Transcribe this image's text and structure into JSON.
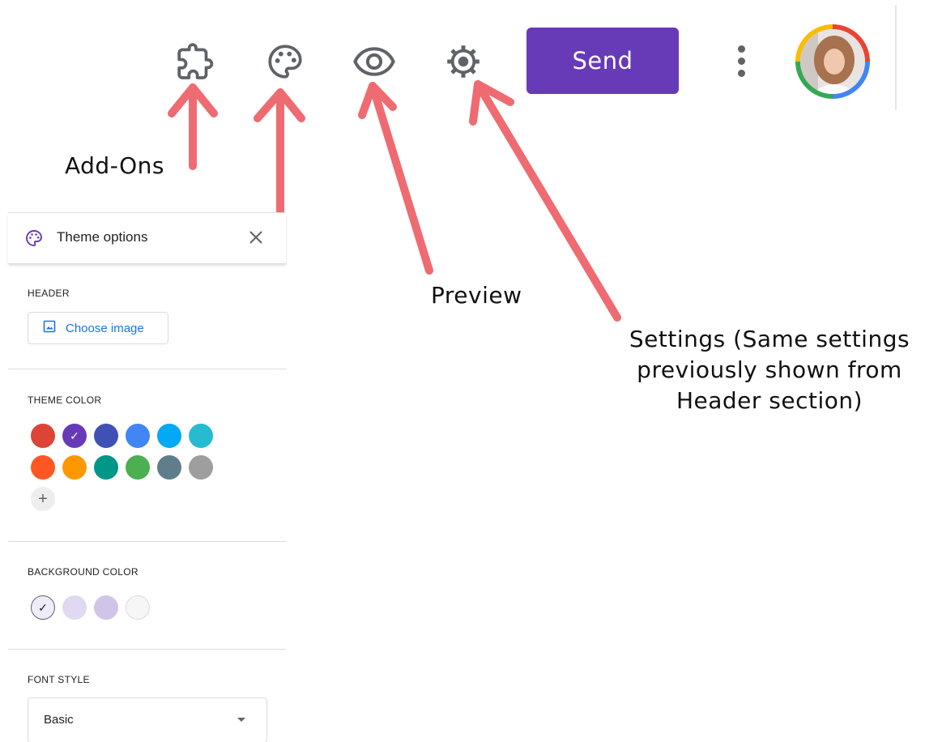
{
  "toolbar": {
    "icons": [
      "puzzle-icon",
      "palette-icon",
      "eye-icon",
      "gear-icon"
    ],
    "send_label": "Send",
    "send_color": "#673ab7",
    "more_icon": "more-vert-icon"
  },
  "annotations": {
    "addons": "Add-Ons",
    "preview": "Preview",
    "settings_line1": "Settings (Same settings",
    "settings_line2": "previously shown from",
    "settings_line3": "Header section)",
    "arrow_color": "#ef6b72"
  },
  "theme_panel": {
    "title": "Theme options",
    "header_label": "HEADER",
    "choose_image": "Choose image",
    "theme_color_label": "THEME COLOR",
    "theme_colors": [
      "#db4437",
      "#673ab7",
      "#3f51b5",
      "#4285f4",
      "#03a9f4",
      "#26bbd0",
      "#ff5722",
      "#ff9800",
      "#009688",
      "#4caf50",
      "#607d8b",
      "#9e9e9e"
    ],
    "theme_selected": "#673ab7",
    "add_label": "+",
    "background_label": "BACKGROUND COLOR",
    "background_colors": [
      "#f0ebf8",
      "#e1d8f1",
      "#d1c4e9",
      "#f6f6f6"
    ],
    "background_selected": "#f0ebf8",
    "font_label": "FONT STYLE",
    "font_value": "Basic"
  }
}
